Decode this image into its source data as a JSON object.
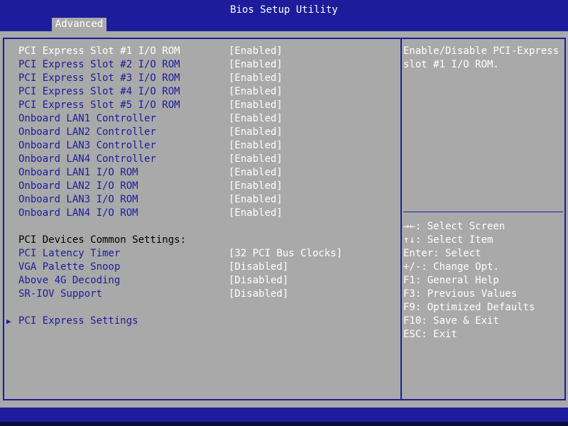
{
  "window": {
    "title": "Bios Setup Utility"
  },
  "tabs": [
    {
      "label": "Advanced"
    }
  ],
  "settings": [
    {
      "label": "PCI Express Slot #1 I/O ROM",
      "value": "[Enabled]"
    },
    {
      "label": "PCI Express Slot #2 I/O ROM",
      "value": "[Enabled]"
    },
    {
      "label": "PCI Express Slot #3 I/O ROM",
      "value": "[Enabled]"
    },
    {
      "label": "PCI Express Slot #4 I/O ROM",
      "value": "[Enabled]"
    },
    {
      "label": "PCI Express Slot #5 I/O ROM",
      "value": "[Enabled]"
    },
    {
      "label": "Onboard LAN1 Controller",
      "value": "[Enabled]"
    },
    {
      "label": "Onboard LAN2 Controller",
      "value": "[Enabled]"
    },
    {
      "label": "Onboard LAN3 Controller",
      "value": "[Enabled]"
    },
    {
      "label": "Onboard LAN4 Controller",
      "value": "[Enabled]"
    },
    {
      "label": "Onboard LAN1 I/O ROM",
      "value": "[Enabled]"
    },
    {
      "label": "Onboard LAN2 I/O ROM",
      "value": "[Enabled]"
    },
    {
      "label": "Onboard LAN3 I/O ROM",
      "value": "[Enabled]"
    },
    {
      "label": "Onboard LAN4 I/O ROM",
      "value": "[Enabled]"
    }
  ],
  "common_section": {
    "heading": "PCI Devices Common Settings:",
    "items": [
      {
        "label": "PCI Latency Timer",
        "value": "[32 PCI Bus Clocks]"
      },
      {
        "label": "VGA Palette Snoop",
        "value": "[Disabled]"
      },
      {
        "label": "Above 4G Decoding",
        "value": "[Disabled]"
      },
      {
        "label": "SR-IOV Support",
        "value": "[Disabled]"
      }
    ]
  },
  "submenu": {
    "label": "PCI Express Settings",
    "icon": "triangle-right-icon"
  },
  "help": {
    "text": "Enable/Disable PCI-Express slot #1 I/O ROM."
  },
  "keys": [
    {
      "key": "→←",
      "desc": ": Select Screen"
    },
    {
      "key": "↑↓",
      "desc": ": Select Item"
    },
    {
      "key": "Enter",
      "desc": ": Select"
    },
    {
      "key": "+/-",
      "desc": ": Change Opt."
    },
    {
      "key": "F1",
      "desc": ": General Help"
    },
    {
      "key": "F3",
      "desc": ": Previous Values"
    },
    {
      "key": "F9",
      "desc": ": Optimized Defaults"
    },
    {
      "key": "F10",
      "desc": ": Save & Exit"
    },
    {
      "key": "ESC",
      "desc": ": Exit"
    }
  ],
  "colors": {
    "background": "#a9a9a9",
    "accent": "#1c1c9c",
    "highlight": "#ffffff"
  }
}
